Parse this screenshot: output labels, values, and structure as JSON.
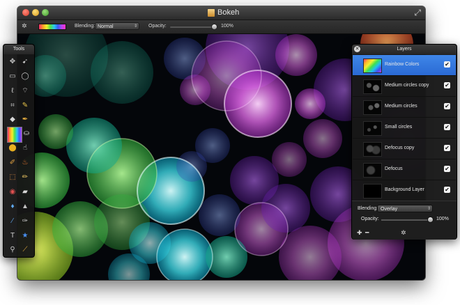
{
  "window": {
    "title": "Bokeh",
    "fullscreen_icon": "fullscreen-arrows-icon"
  },
  "options_bar": {
    "settings_icon": "gear-icon",
    "blending_label": "Blending:",
    "blending_value": "Normal",
    "opacity_label": "Opacity:",
    "opacity_value": "100%",
    "opacity_level": 1.0
  },
  "tools_palette": {
    "title": "Tools",
    "tools": [
      "move-icon",
      "pointer-select-icon",
      "rect-select-icon",
      "ellipse-select-icon",
      "lasso-icon",
      "polygon-lasso-icon",
      "crop-icon",
      "eyedropper-icon",
      "eraser-icon",
      "pen-icon",
      "gradient-swatch",
      "paint-bucket-icon",
      "color-fill-icon",
      "smudge-icon",
      "brush-icon",
      "burn-icon",
      "clone-stamp-icon",
      "pencil-icon",
      "red-eye-icon",
      "eraser-block-icon",
      "blur-drop-icon",
      "sharpen-cone-icon",
      "line-tool-icon",
      "vector-pen-icon",
      "text-tool-icon",
      "shape-star-icon",
      "zoom-icon",
      "picker-icon"
    ]
  },
  "layers_palette": {
    "title": "Layers",
    "layers": [
      {
        "name": "Rainbow Colors",
        "visible": true,
        "selected": true
      },
      {
        "name": "Medium circles copy",
        "visible": true,
        "selected": false
      },
      {
        "name": "Medium circles",
        "visible": true,
        "selected": false
      },
      {
        "name": "Small circles",
        "visible": true,
        "selected": false
      },
      {
        "name": "Defocus copy",
        "visible": true,
        "selected": false
      },
      {
        "name": "Defocus",
        "visible": true,
        "selected": false
      },
      {
        "name": "Background Layer",
        "visible": true,
        "selected": false
      }
    ],
    "blending_label": "Blending:",
    "blending_value": "Overlay",
    "opacity_label": "Opacity:",
    "opacity_value": "100%",
    "opacity_level": 1.0,
    "footer_buttons": [
      "add-layer-icon",
      "remove-layer-icon",
      "layer-settings-gear-icon"
    ]
  },
  "colors": {
    "selected_row": "#3a7ee2",
    "panel_bg": "#181818",
    "canvas_bg": "#04060a"
  }
}
